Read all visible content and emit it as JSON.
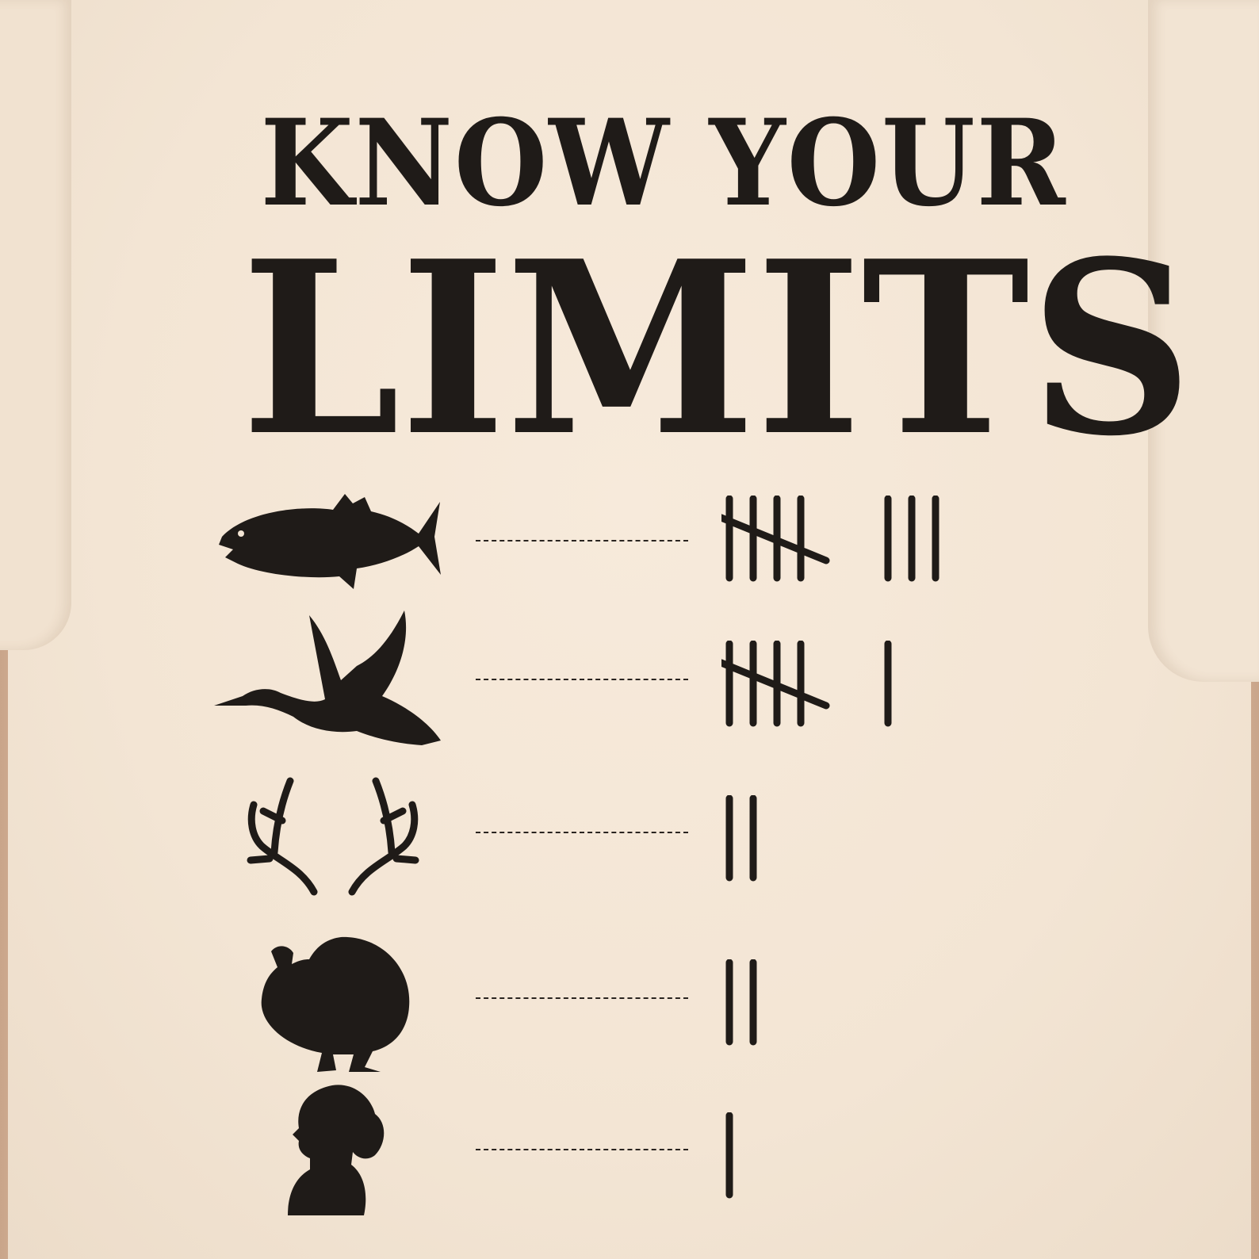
{
  "title": {
    "line1": "KNOW YOUR",
    "line2": "LIMITS"
  },
  "rows": [
    {
      "icon": "fish-icon",
      "tally": 8
    },
    {
      "icon": "duck-icon",
      "tally": 6
    },
    {
      "icon": "antlers-icon",
      "tally": 2
    },
    {
      "icon": "turkey-icon",
      "tally": 2
    },
    {
      "icon": "woman-silhouette-icon",
      "tally": 1
    }
  ],
  "colors": {
    "ink": "#1f1b18",
    "shirt": "#f5e8d8"
  }
}
